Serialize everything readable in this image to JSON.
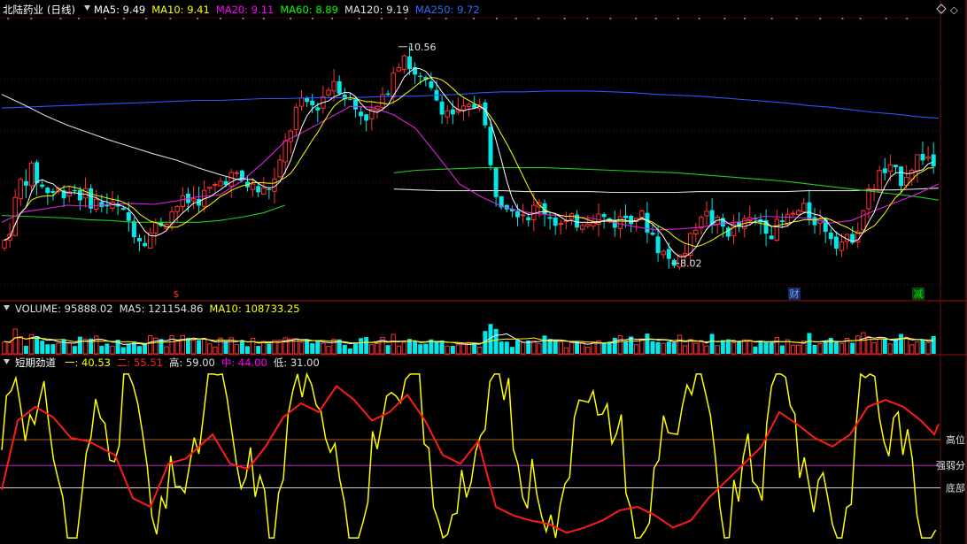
{
  "window": {
    "menu_icon": "diamond-menu-icon"
  },
  "main_panel": {
    "stock_name": "北陆药业",
    "period": "(日线)",
    "indicators": [
      {
        "label": "MA5: 9.49",
        "color": "#ffffff"
      },
      {
        "label": "MA10: 9.41",
        "color": "#ffff00"
      },
      {
        "label": "MA20: 9.11",
        "color": "#ff00ff"
      },
      {
        "label": "MA60: 8.89",
        "color": "#00ff00"
      },
      {
        "label": "MA120: 9.19",
        "color": "#e0e0e0"
      },
      {
        "label": "MA250: 9.72",
        "color": "#2a6bff"
      }
    ],
    "high_marker": "10.56",
    "low_marker": "8.02",
    "event_markers": [
      "$",
      "财",
      "减"
    ]
  },
  "volume_panel": {
    "indicators": [
      {
        "label": "VOLUME: 95888.02",
        "color": "#e0e0e0"
      },
      {
        "label": "MA5: 121154.86",
        "color": "#e0e0e0"
      },
      {
        "label": "MA10: 108733.25",
        "color": "#ffff00"
      }
    ]
  },
  "osc_panel": {
    "name": "短期劲道",
    "indicators": [
      {
        "label": "一: 40.53",
        "color": "#ffff00"
      },
      {
        "label": "二: 55.51",
        "color": "#ff2020"
      },
      {
        "label": "高: 59.00",
        "color": "#e0e0e0"
      },
      {
        "label": "中: 44.00",
        "color": "#ff00ff"
      },
      {
        "label": "低: 31.00",
        "color": "#e0e0e0"
      }
    ],
    "level_labels": [
      "高位",
      "强弱分",
      "底部"
    ]
  },
  "chart_data": {
    "type": "line",
    "price": {
      "ylim": [
        7.6,
        10.9
      ],
      "ma250": [
        9.84,
        9.85,
        9.86,
        9.87,
        9.88,
        9.89,
        9.9,
        9.91,
        9.92,
        9.93,
        9.93,
        9.94,
        9.95,
        9.95,
        9.96,
        9.96,
        9.96,
        9.97,
        9.98,
        9.98,
        9.99,
        10,
        10.02,
        10.03,
        10.03,
        10.04,
        10.04,
        10.04,
        10.03,
        10.02,
        10,
        9.99,
        9.98,
        9.96,
        9.94,
        9.92,
        9.9,
        9.87,
        9.85,
        9.82,
        9.79,
        9.77,
        9.74,
        9.72
      ],
      "ma120": [
        10.0,
        9.88,
        9.75,
        9.64,
        9.55,
        9.46,
        9.38,
        9.3,
        9.23,
        9.14,
        9.06,
        8.99,
        null,
        null,
        null,
        null,
        null,
        null,
        8.89,
        8.88,
        8.87,
        8.87,
        8.87,
        8.87,
        8.86,
        8.86,
        8.86,
        8.86,
        8.85,
        8.85,
        8.85,
        8.85,
        8.86,
        8.86,
        8.86,
        8.86,
        8.86,
        8.87,
        8.87,
        8.87,
        8.88,
        8.88,
        8.89,
        8.9
      ],
      "ma60": [
        8.58,
        8.57,
        8.56,
        8.55,
        8.53,
        8.52,
        8.5,
        8.5,
        8.5,
        8.5,
        8.52,
        8.56,
        8.61,
        8.7,
        null,
        null,
        null,
        null,
        9.08,
        9.11,
        9.12,
        9.13,
        9.14,
        9.14,
        9.14,
        9.14,
        9.13,
        9.12,
        9.11,
        9.1,
        9.09,
        9.08,
        9.06,
        9.04,
        9.02,
        9.0,
        8.98,
        8.95,
        8.92,
        8.89,
        8.86,
        8.83,
        8.8,
        8.76
      ],
      "ma20": [
        8.5,
        8.62,
        8.66,
        8.7,
        8.69,
        8.71,
        8.72,
        8.71,
        8.75,
        8.8,
        8.82,
        8.98,
        9.2,
        9.45,
        9.58,
        9.72,
        9.86,
        9.85,
        9.76,
        9.6,
        9.28,
        8.95,
        8.8,
        8.68,
        8.62,
        8.59,
        8.57,
        8.55,
        8.5,
        8.45,
        8.41,
        8.42,
        8.44,
        8.48,
        8.51,
        8.57,
        8.56,
        8.55,
        8.49,
        8.52,
        8.63,
        8.73,
        8.83,
        8.95
      ]
    },
    "volume": {
      "ylim": [
        0,
        300000
      ]
    },
    "oscillator": {
      "ylim": [
        0,
        100
      ],
      "high_level": 59.0,
      "mid_level": 44.0,
      "low_level": 31.0
    }
  }
}
